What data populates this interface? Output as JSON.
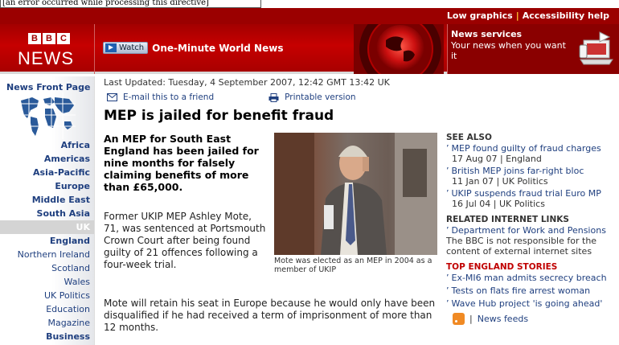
{
  "error_bar": {
    "text": "[an error occurred while processing this directive]"
  },
  "top_links": {
    "low_graphics": "Low graphics",
    "separator": "|",
    "accessibility": "Accessibility help"
  },
  "banner": {
    "logo_letters": [
      "B",
      "B",
      "C"
    ],
    "logo_word": "NEWS",
    "watch_label": "Watch",
    "watch_title": "One-Minute World News",
    "news_services_title": "News services",
    "news_services_text": "Your news when you want it",
    "accent": "#a30000"
  },
  "sidebar": {
    "front_page": "News Front Page",
    "items": [
      {
        "label": "Africa",
        "style": "bold"
      },
      {
        "label": "Americas",
        "style": "bold"
      },
      {
        "label": "Asia-Pacific",
        "style": "bold"
      },
      {
        "label": "Europe",
        "style": "bold"
      },
      {
        "label": "Middle East",
        "style": "bold"
      },
      {
        "label": "South Asia",
        "style": "bold"
      },
      {
        "label": "UK",
        "style": "selected"
      },
      {
        "label": "England",
        "style": "bold"
      },
      {
        "label": "Northern Ireland",
        "style": "sub"
      },
      {
        "label": "Scotland",
        "style": "sub"
      },
      {
        "label": "Wales",
        "style": "sub"
      },
      {
        "label": "UK Politics",
        "style": "sub"
      },
      {
        "label": "Education",
        "style": "sub"
      },
      {
        "label": "Magazine",
        "style": "sub"
      },
      {
        "label": "Business",
        "style": "bold"
      }
    ]
  },
  "article": {
    "last_updated": "Last Updated: Tuesday, 4 September 2007, 12:42 GMT 13:42 UK",
    "email_link": "E-mail this to a friend",
    "print_link": "Printable version",
    "headline": "MEP is jailed for benefit fraud",
    "intro": "An MEP for South East England has been jailed for nine months for falsely claiming benefits of more than £65,000.",
    "para1": "Former UKIP MEP Ashley Mote, 71, was sentenced at Portsmouth Crown Court after being found guilty of 21 offences following a four-week trial.",
    "para2": "Mote will retain his seat in Europe because he would only have been disqualified if he had received a term of imprisonment of more than 12 months.",
    "photo_caption": "Mote was elected as an MEP in 2004 as a member of UKIP"
  },
  "see_also": {
    "heading": "SEE ALSO",
    "items": [
      {
        "title": "MEP found guilty of fraud charges",
        "meta": "17 Aug 07 |  England"
      },
      {
        "title": "British MEP joins far-right bloc",
        "meta": "11 Jan 07 |  UK Politics"
      },
      {
        "title": "UKIP suspends fraud trial Euro MP",
        "meta": "16 Jul 04 |  UK Politics"
      }
    ]
  },
  "related": {
    "heading": "RELATED INTERNET LINKS",
    "link": "Department for Work and Pensions",
    "note": "The BBC is not responsible for the content of external internet sites"
  },
  "top_stories": {
    "heading": "TOP ENGLAND STORIES",
    "items": [
      "Ex-MI6 man admits secrecy breach",
      "Tests on flats fire arrest woman",
      "Wave Hub project 'is going ahead'"
    ]
  },
  "feeds": {
    "separator": "|",
    "label": "News feeds"
  }
}
